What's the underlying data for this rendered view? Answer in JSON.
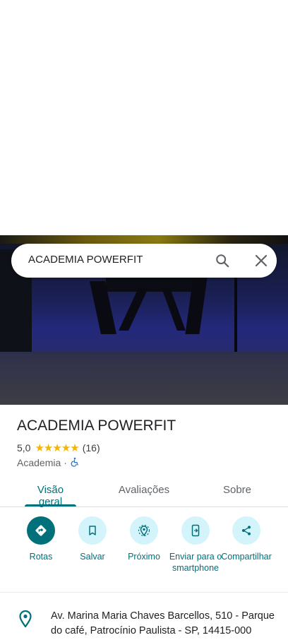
{
  "search": {
    "query": "ACADEMIA POWERFIT"
  },
  "place": {
    "name": "ACADEMIA POWERFIT",
    "rating": "5,0",
    "stars": "★★★★★",
    "review_count": "(16)",
    "category": "Academia",
    "separator": "·"
  },
  "tabs": [
    {
      "label": "Visão geral",
      "active": true
    },
    {
      "label": "Avaliações",
      "active": false
    },
    {
      "label": "Sobre",
      "active": false
    }
  ],
  "actions": [
    {
      "label": "Rotas",
      "icon": "directions-icon"
    },
    {
      "label": "Salvar",
      "icon": "bookmark-icon"
    },
    {
      "label": "Próximo",
      "icon": "nearby-icon"
    },
    {
      "label": "Enviar para o smartphone",
      "icon": "send-to-phone-icon"
    },
    {
      "label": "Compartilhar",
      "icon": "share-icon"
    }
  ],
  "address": {
    "text": "Av. Marina Maria Chaves Barcellos, 510 - Parque do café, Patrocínio Paulista - SP, 14415-000"
  },
  "colors": {
    "accent": "#00707a",
    "action_bg": "#d2f4fa",
    "star": "#f4b400"
  }
}
